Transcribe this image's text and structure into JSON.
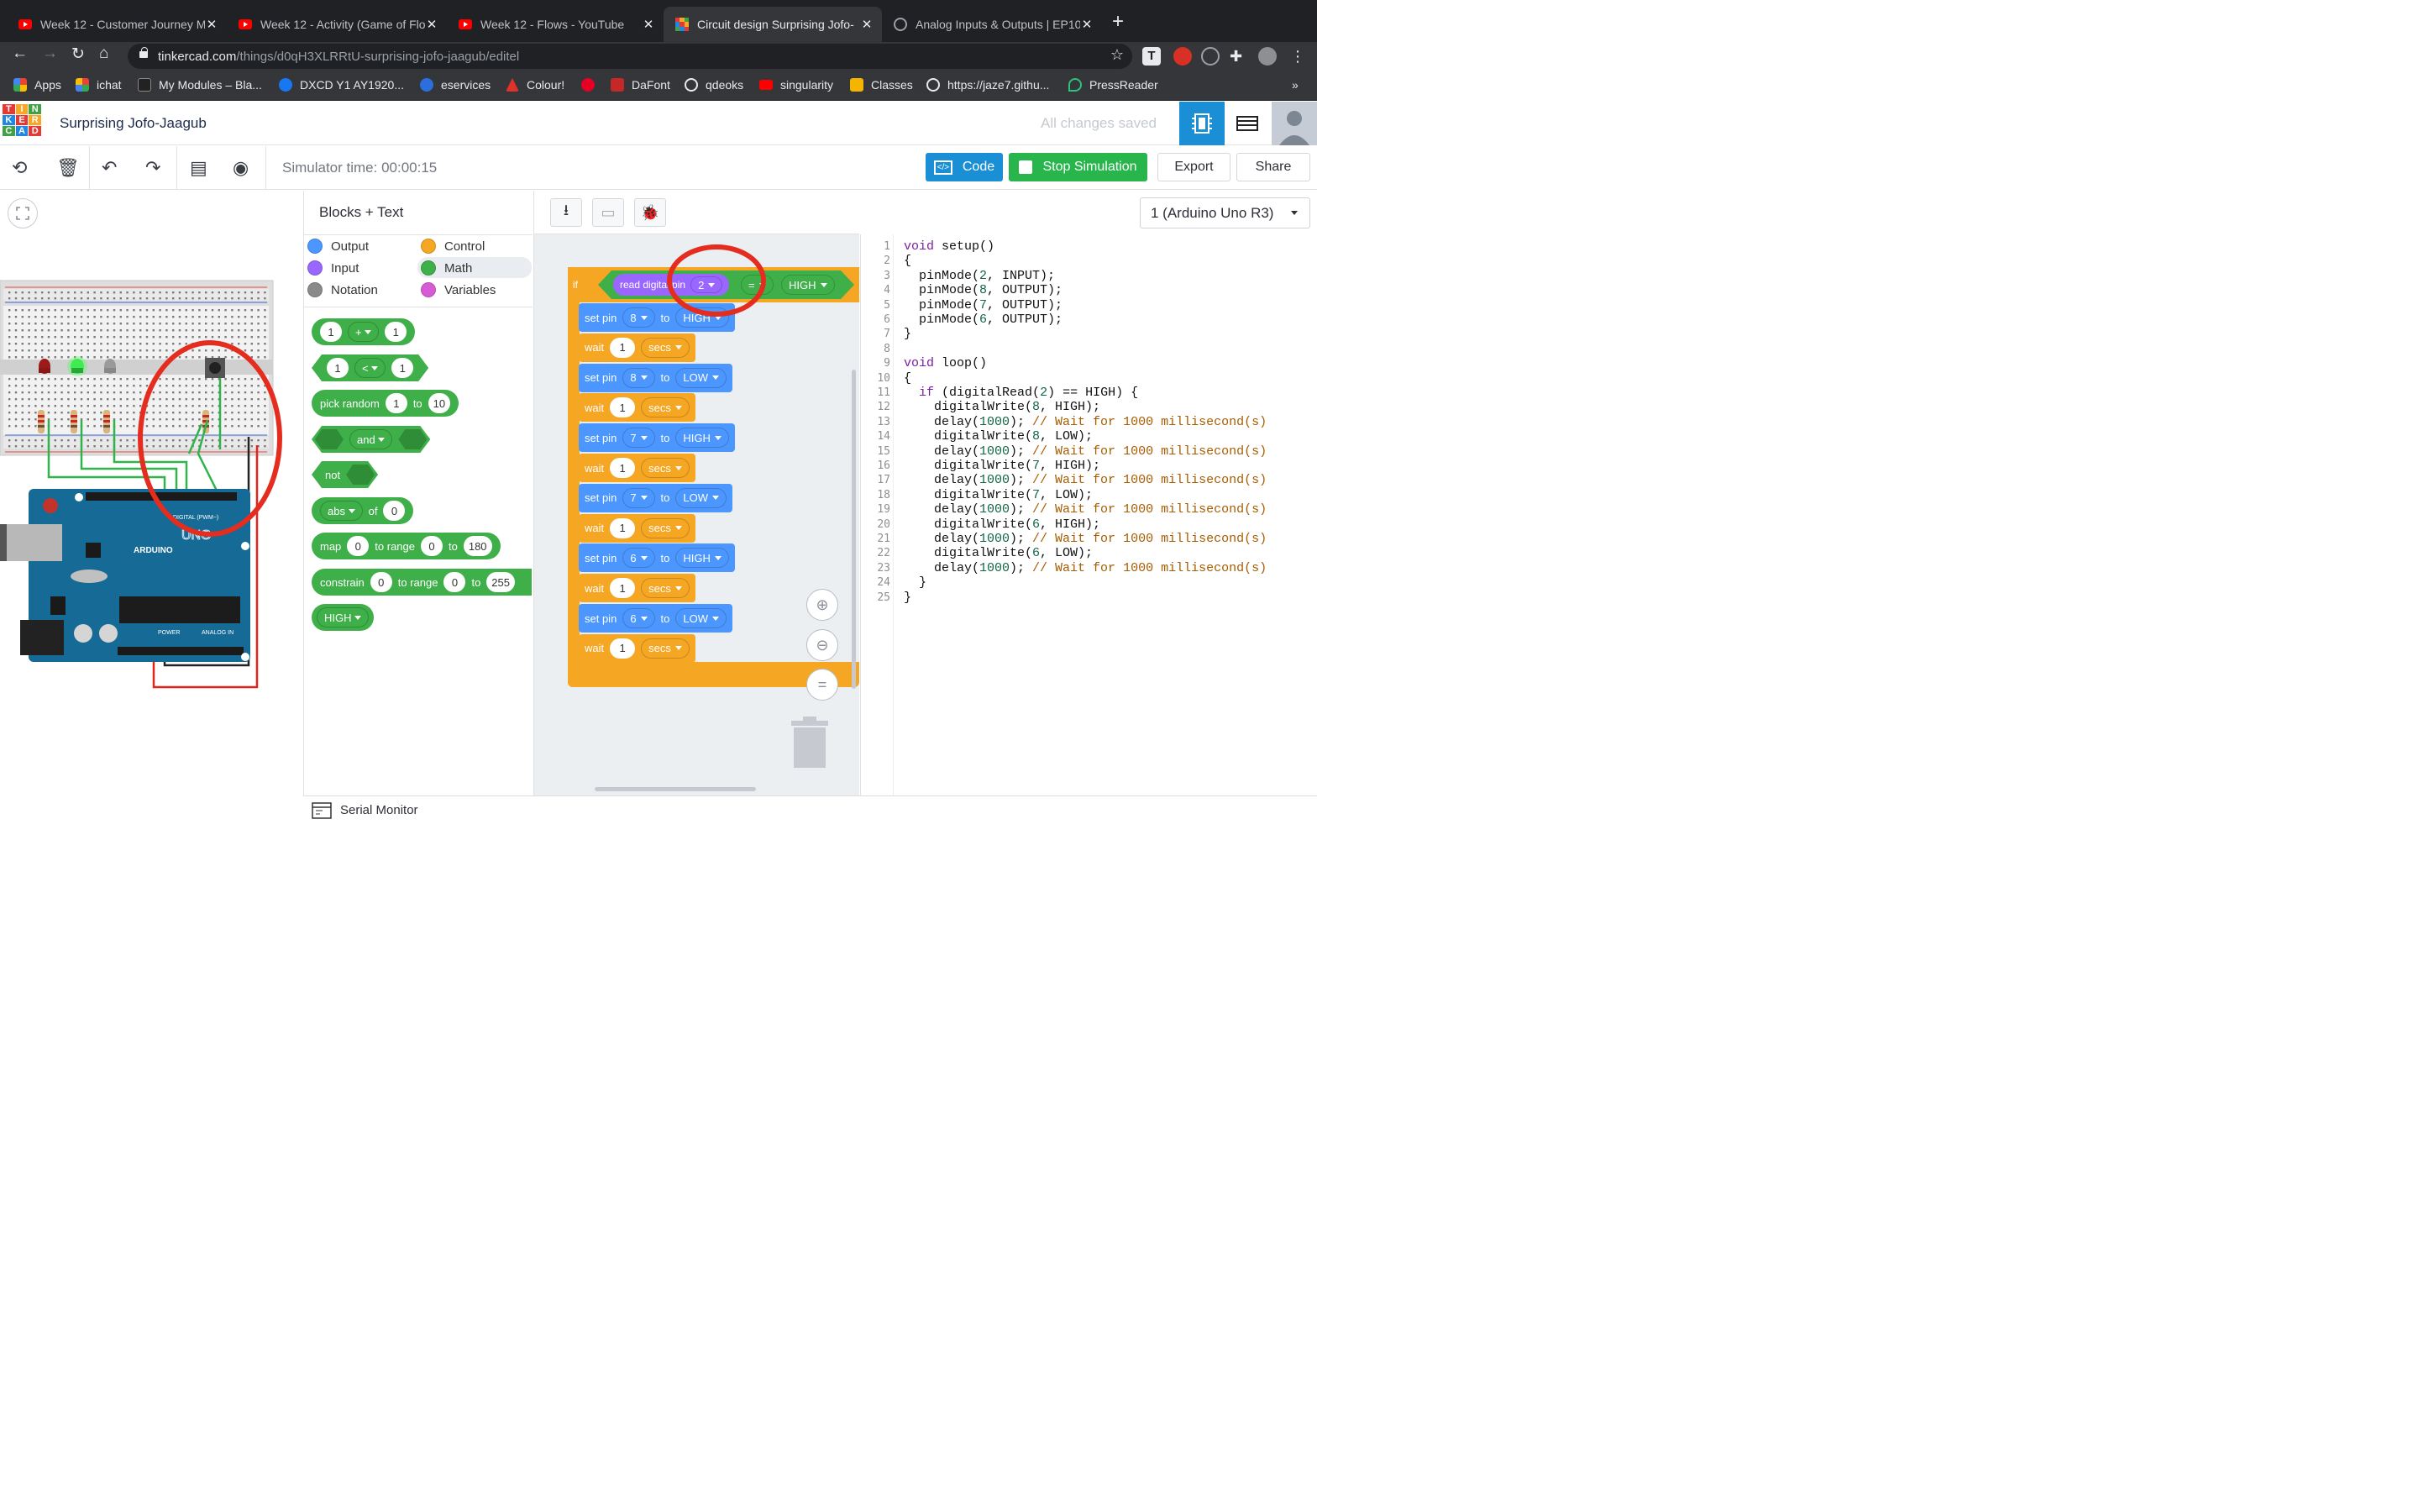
{
  "browser": {
    "tabs": [
      {
        "title": "Week 12 - Customer Journey M",
        "icon": "youtube-icon"
      },
      {
        "title": "Week 12 - Activity (Game of Flo",
        "icon": "youtube-icon"
      },
      {
        "title": "Week 12 - Flows - YouTube",
        "icon": "youtube-icon"
      },
      {
        "title": "Circuit design Surprising Jofo-",
        "icon": "tinkercad-icon",
        "active": true
      },
      {
        "title": "Analog Inputs & Outputs | EP10",
        "icon": "globe-icon"
      }
    ],
    "url_host": "tinkercad.com",
    "url_path": "/things/d0qH3XLRRtU-surprising-jofo-jaagub/editel",
    "bookmarks": [
      "Apps",
      "ichat",
      "My Modules – Bla...",
      "DXCD Y1 AY1920...",
      "eservices",
      "Colour!",
      "",
      "DaFont",
      "qdeoks",
      "singularity",
      "Classes",
      "https://jaze7.githu...",
      "PressReader"
    ],
    "bookmark_overflow": "»"
  },
  "header": {
    "logo_letters": [
      "T",
      "I",
      "N",
      "K",
      "E",
      "R",
      "C",
      "A",
      "D"
    ],
    "project_name": "Surprising Jofo-Jaagub",
    "save_status": "All changes saved"
  },
  "toolbar": {
    "sim_time": "Simulator time: 00:00:15",
    "code_btn": "Code",
    "stop_btn": "Stop Simulation",
    "export_btn": "Export",
    "share_btn": "Share"
  },
  "blocks_panel": {
    "mode": "Blocks + Text",
    "categories": [
      {
        "label": "Output",
        "color": "#4c97ff"
      },
      {
        "label": "Control",
        "color": "#f5a623"
      },
      {
        "label": "Input",
        "color": "#9966ff"
      },
      {
        "label": "Math",
        "color": "#3fb049"
      },
      {
        "label": "Notation",
        "color": "#8a8a8a"
      },
      {
        "label": "Variables",
        "color": "#d65cd6"
      }
    ],
    "math_blocks": {
      "add": {
        "a": "1",
        "op": "+",
        "b": "1"
      },
      "compare": {
        "a": "1",
        "op": "<",
        "b": "1"
      },
      "random": {
        "label": "pick random",
        "from": "1",
        "to_label": "to",
        "to": "10"
      },
      "and": {
        "label": "and"
      },
      "not": {
        "label": "not"
      },
      "abs": {
        "label": "abs",
        "of": "of",
        "value": "0"
      },
      "map": {
        "label": "map",
        "v": "0",
        "range_label": "to range",
        "lo": "0",
        "to_label": "to",
        "hi": "180"
      },
      "constrain": {
        "label": "constrain",
        "v": "0",
        "range_label": "to range",
        "lo": "0",
        "to_label": "to",
        "hi": "255"
      },
      "high": {
        "label": "HIGH"
      }
    }
  },
  "editor": {
    "board": "1 (Arduino Uno R3)",
    "if_block": {
      "kw": "if",
      "read": "read digital pin",
      "pin": "2",
      "op": "=",
      "value": "HIGH"
    },
    "steps": [
      {
        "type": "set",
        "label": "set pin",
        "pin": "8",
        "to": "to",
        "val": "HIGH"
      },
      {
        "type": "wait",
        "label": "wait",
        "n": "1",
        "unit": "secs"
      },
      {
        "type": "set",
        "label": "set pin",
        "pin": "8",
        "to": "to",
        "val": "LOW"
      },
      {
        "type": "wait",
        "label": "wait",
        "n": "1",
        "unit": "secs"
      },
      {
        "type": "set",
        "label": "set pin",
        "pin": "7",
        "to": "to",
        "val": "HIGH"
      },
      {
        "type": "wait",
        "label": "wait",
        "n": "1",
        "unit": "secs"
      },
      {
        "type": "set",
        "label": "set pin",
        "pin": "7",
        "to": "to",
        "val": "LOW"
      },
      {
        "type": "wait",
        "label": "wait",
        "n": "1",
        "unit": "secs"
      },
      {
        "type": "set",
        "label": "set pin",
        "pin": "6",
        "to": "to",
        "val": "HIGH"
      },
      {
        "type": "wait",
        "label": "wait",
        "n": "1",
        "unit": "secs"
      },
      {
        "type": "set",
        "label": "set pin",
        "pin": "6",
        "to": "to",
        "val": "LOW"
      },
      {
        "type": "wait",
        "label": "wait",
        "n": "1",
        "unit": "secs"
      }
    ]
  },
  "code_lines": [
    "void setup()",
    "{",
    "  pinMode(2, INPUT);",
    "  pinMode(8, OUTPUT);",
    "  pinMode(7, OUTPUT);",
    "  pinMode(6, OUTPUT);",
    "}",
    "",
    "void loop()",
    "{",
    "  if (digitalRead(2) == HIGH) {",
    "    digitalWrite(8, HIGH);",
    "    delay(1000); // Wait for 1000 millisecond(s)",
    "    digitalWrite(8, LOW);",
    "    delay(1000); // Wait for 1000 millisecond(s)",
    "    digitalWrite(7, HIGH);",
    "    delay(1000); // Wait for 1000 millisecond(s)",
    "    digitalWrite(7, LOW);",
    "    delay(1000); // Wait for 1000 millisecond(s)",
    "    digitalWrite(6, HIGH);",
    "    delay(1000); // Wait for 1000 millisecond(s)",
    "    digitalWrite(6, LOW);",
    "    delay(1000); // Wait for 1000 millisecond(s)",
    "  }",
    "}"
  ],
  "board_labels": {
    "brand": "ARDUINO",
    "model": "UNO",
    "power": "POWER",
    "analog": "ANALOG IN",
    "digital": "DIGITAL (PWM~)"
  },
  "serial_monitor": "Serial Monitor",
  "colors": {
    "accent": "#1b8fd6",
    "stop": "#27b54c",
    "annotation": "#e52d1f"
  }
}
